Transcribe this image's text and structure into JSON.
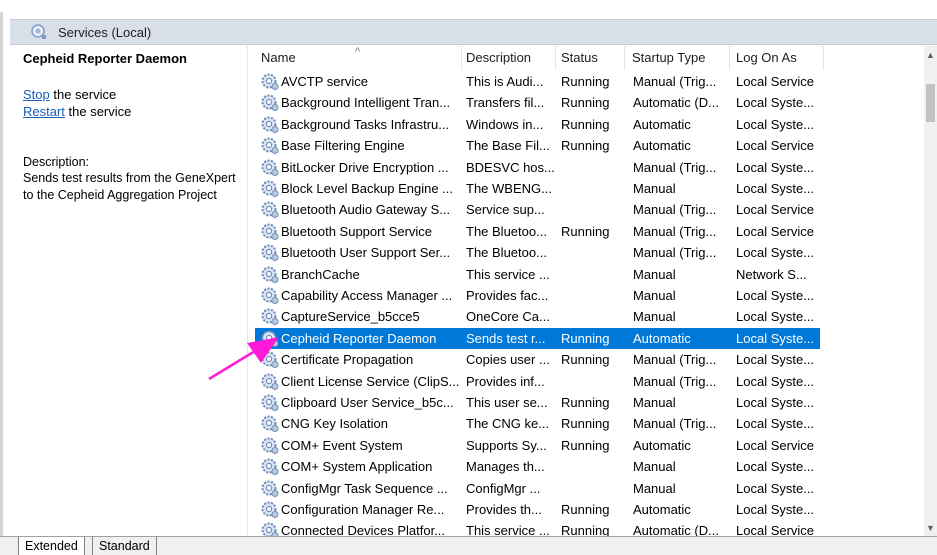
{
  "header": {
    "title": "Services (Local)"
  },
  "description_pane": {
    "service_title": "Cepheid Reporter Daemon",
    "stop_link": "Stop",
    "stop_suffix": " the service",
    "restart_link": "Restart",
    "restart_suffix": " the service",
    "description_label": "Description:",
    "description_text": "Sends test results from the GeneXpert to the Cepheid Aggregation Project"
  },
  "columns": {
    "name": "Name",
    "description": "Description",
    "status": "Status",
    "startup": "Startup Type",
    "logon": "Log On As",
    "sort_indicator": "^"
  },
  "rows": [
    {
      "name": "AVCTP service",
      "description": "This is Audi...",
      "status": "Running",
      "startup": "Manual (Trig...",
      "logon": "Local Service"
    },
    {
      "name": "Background Intelligent Tran...",
      "description": "Transfers fil...",
      "status": "Running",
      "startup": "Automatic (D...",
      "logon": "Local Syste..."
    },
    {
      "name": "Background Tasks Infrastru...",
      "description": "Windows in...",
      "status": "Running",
      "startup": "Automatic",
      "logon": "Local Syste..."
    },
    {
      "name": "Base Filtering Engine",
      "description": "The Base Fil...",
      "status": "Running",
      "startup": "Automatic",
      "logon": "Local Service"
    },
    {
      "name": "BitLocker Drive Encryption ...",
      "description": "BDESVC hos...",
      "status": "",
      "startup": "Manual (Trig...",
      "logon": "Local Syste..."
    },
    {
      "name": "Block Level Backup Engine ...",
      "description": "The WBENG...",
      "status": "",
      "startup": "Manual",
      "logon": "Local Syste..."
    },
    {
      "name": "Bluetooth Audio Gateway S...",
      "description": "Service sup...",
      "status": "",
      "startup": "Manual (Trig...",
      "logon": "Local Service"
    },
    {
      "name": "Bluetooth Support Service",
      "description": "The Bluetoo...",
      "status": "Running",
      "startup": "Manual (Trig...",
      "logon": "Local Service"
    },
    {
      "name": "Bluetooth User Support Ser...",
      "description": "The Bluetoo...",
      "status": "",
      "startup": "Manual (Trig...",
      "logon": "Local Syste..."
    },
    {
      "name": "BranchCache",
      "description": "This service ...",
      "status": "",
      "startup": "Manual",
      "logon": "Network S..."
    },
    {
      "name": "Capability Access Manager ...",
      "description": "Provides fac...",
      "status": "",
      "startup": "Manual",
      "logon": "Local Syste..."
    },
    {
      "name": "CaptureService_b5cce5",
      "description": "OneCore Ca...",
      "status": "",
      "startup": "Manual",
      "logon": "Local Syste..."
    },
    {
      "name": "Cepheid Reporter Daemon",
      "description": "Sends test r...",
      "status": "Running",
      "startup": "Automatic",
      "logon": "Local Syste...",
      "selected": true
    },
    {
      "name": "Certificate Propagation",
      "description": "Copies user ...",
      "status": "Running",
      "startup": "Manual (Trig...",
      "logon": "Local Syste..."
    },
    {
      "name": "Client License Service (ClipS...",
      "description": "Provides inf...",
      "status": "",
      "startup": "Manual (Trig...",
      "logon": "Local Syste..."
    },
    {
      "name": "Clipboard User Service_b5c...",
      "description": "This user se...",
      "status": "Running",
      "startup": "Manual",
      "logon": "Local Syste..."
    },
    {
      "name": "CNG Key Isolation",
      "description": "The CNG ke...",
      "status": "Running",
      "startup": "Manual (Trig...",
      "logon": "Local Syste..."
    },
    {
      "name": "COM+ Event System",
      "description": "Supports Sy...",
      "status": "Running",
      "startup": "Automatic",
      "logon": "Local Service"
    },
    {
      "name": "COM+ System Application",
      "description": "Manages th...",
      "status": "",
      "startup": "Manual",
      "logon": "Local Syste..."
    },
    {
      "name": "ConfigMgr Task Sequence ...",
      "description": "ConfigMgr ...",
      "status": "",
      "startup": "Manual",
      "logon": "Local Syste..."
    },
    {
      "name": "Configuration Manager Re...",
      "description": "Provides th...",
      "status": "Running",
      "startup": "Automatic",
      "logon": "Local Syste..."
    },
    {
      "name": "Connected Devices Platfor...",
      "description": "This service ...",
      "status": "Running",
      "startup": "Automatic (D...",
      "logon": "Local Service"
    }
  ],
  "tabs": {
    "extended": "Extended",
    "standard": "Standard"
  },
  "colors": {
    "selection": "#0078d7",
    "link": "#1a5fb4",
    "annotation_arrow": "#ff1ad9"
  },
  "icons": {
    "service": "gear-icon",
    "header": "services-icon",
    "annotation": "pointer-arrow"
  }
}
